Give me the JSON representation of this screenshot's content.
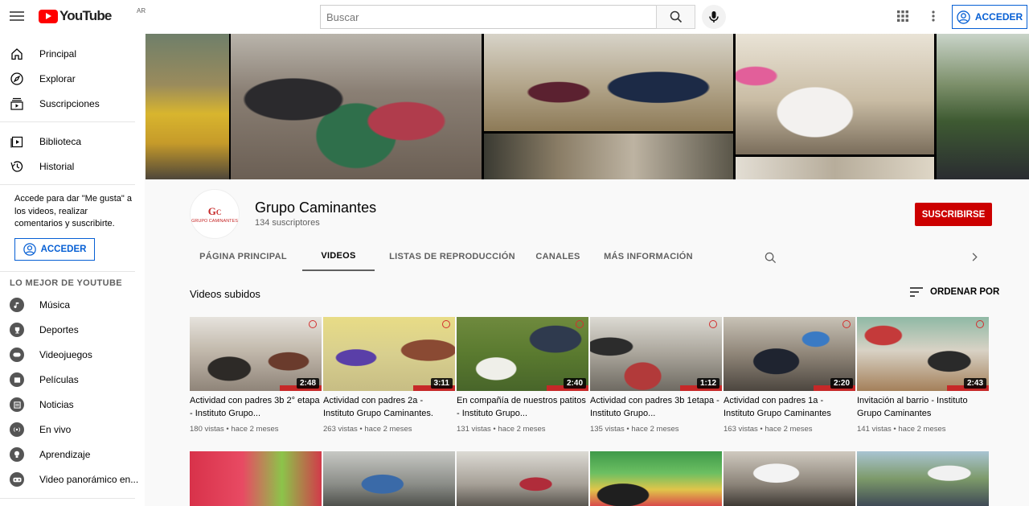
{
  "topbar": {
    "logo_text": "YouTube",
    "country": "AR",
    "search_placeholder": "Buscar",
    "signin_label": "ACCEDER"
  },
  "sidebar": {
    "main": [
      {
        "label": "Principal",
        "icon": "home-icon"
      },
      {
        "label": "Explorar",
        "icon": "compass-icon"
      },
      {
        "label": "Suscripciones",
        "icon": "subscriptions-icon"
      }
    ],
    "library": [
      {
        "label": "Biblioteca",
        "icon": "library-icon"
      },
      {
        "label": "Historial",
        "icon": "history-icon"
      }
    ],
    "signin_message": "Accede para dar \"Me gusta\" a los videos, realizar comentarios y suscribirte.",
    "signin_label": "ACCEDER",
    "best_title": "LO MEJOR DE YOUTUBE",
    "best": [
      {
        "label": "Música",
        "icon": "music-icon"
      },
      {
        "label": "Deportes",
        "icon": "trophy-icon"
      },
      {
        "label": "Videojuegos",
        "icon": "gamepad-icon"
      },
      {
        "label": "Películas",
        "icon": "film-icon"
      },
      {
        "label": "Noticias",
        "icon": "news-icon"
      },
      {
        "label": "En vivo",
        "icon": "live-icon"
      },
      {
        "label": "Aprendizaje",
        "icon": "lightbulb-icon"
      },
      {
        "label": "Video panorámico en...",
        "icon": "vr-icon"
      }
    ]
  },
  "channel": {
    "name": "Grupo Caminantes",
    "subscribers": "134 suscriptores",
    "avatar_text": "GRUPO CAMINANTES",
    "subscribe_label": "SUSCRIBIRSE",
    "tabs": [
      "PÁGINA PRINCIPAL",
      "VIDEOS",
      "LISTAS DE REPRODUCCIÓN",
      "CANALES",
      "MÁS INFORMACIÓN"
    ],
    "active_tab": "VIDEOS"
  },
  "shelf": {
    "title": "Videos subidos",
    "sort_label": "ORDENAR POR"
  },
  "videos": [
    {
      "title": "Actividad con padres 3b 2° etapa - Instituto Grupo...",
      "duration": "2:48",
      "views": "180 vistas",
      "age": "hace 2 meses"
    },
    {
      "title": "Actividad con padres 2a - Instituto Grupo Caminantes.",
      "duration": "3:11",
      "views": "263 vistas",
      "age": "hace 2 meses"
    },
    {
      "title": "En compañía de nuestros patitos - Instituto Grupo...",
      "duration": "2:40",
      "views": "131 vistas",
      "age": "hace 2 meses"
    },
    {
      "title": "Actividad con padres 3b 1etapa - Instituto Grupo...",
      "duration": "1:12",
      "views": "135 vistas",
      "age": "hace 2 meses"
    },
    {
      "title": "Actividad con padres 1a - Instituto Grupo Caminantes",
      "duration": "2:20",
      "views": "163 vistas",
      "age": "hace 2 meses"
    },
    {
      "title": "Invitación al barrio - Instituto Grupo Caminantes",
      "duration": "2:43",
      "views": "141 vistas",
      "age": "hace 2 meses"
    }
  ],
  "colors": {
    "brand_red": "#ff0000",
    "subscribe_red": "#cc0000",
    "link_blue": "#065fd4"
  }
}
